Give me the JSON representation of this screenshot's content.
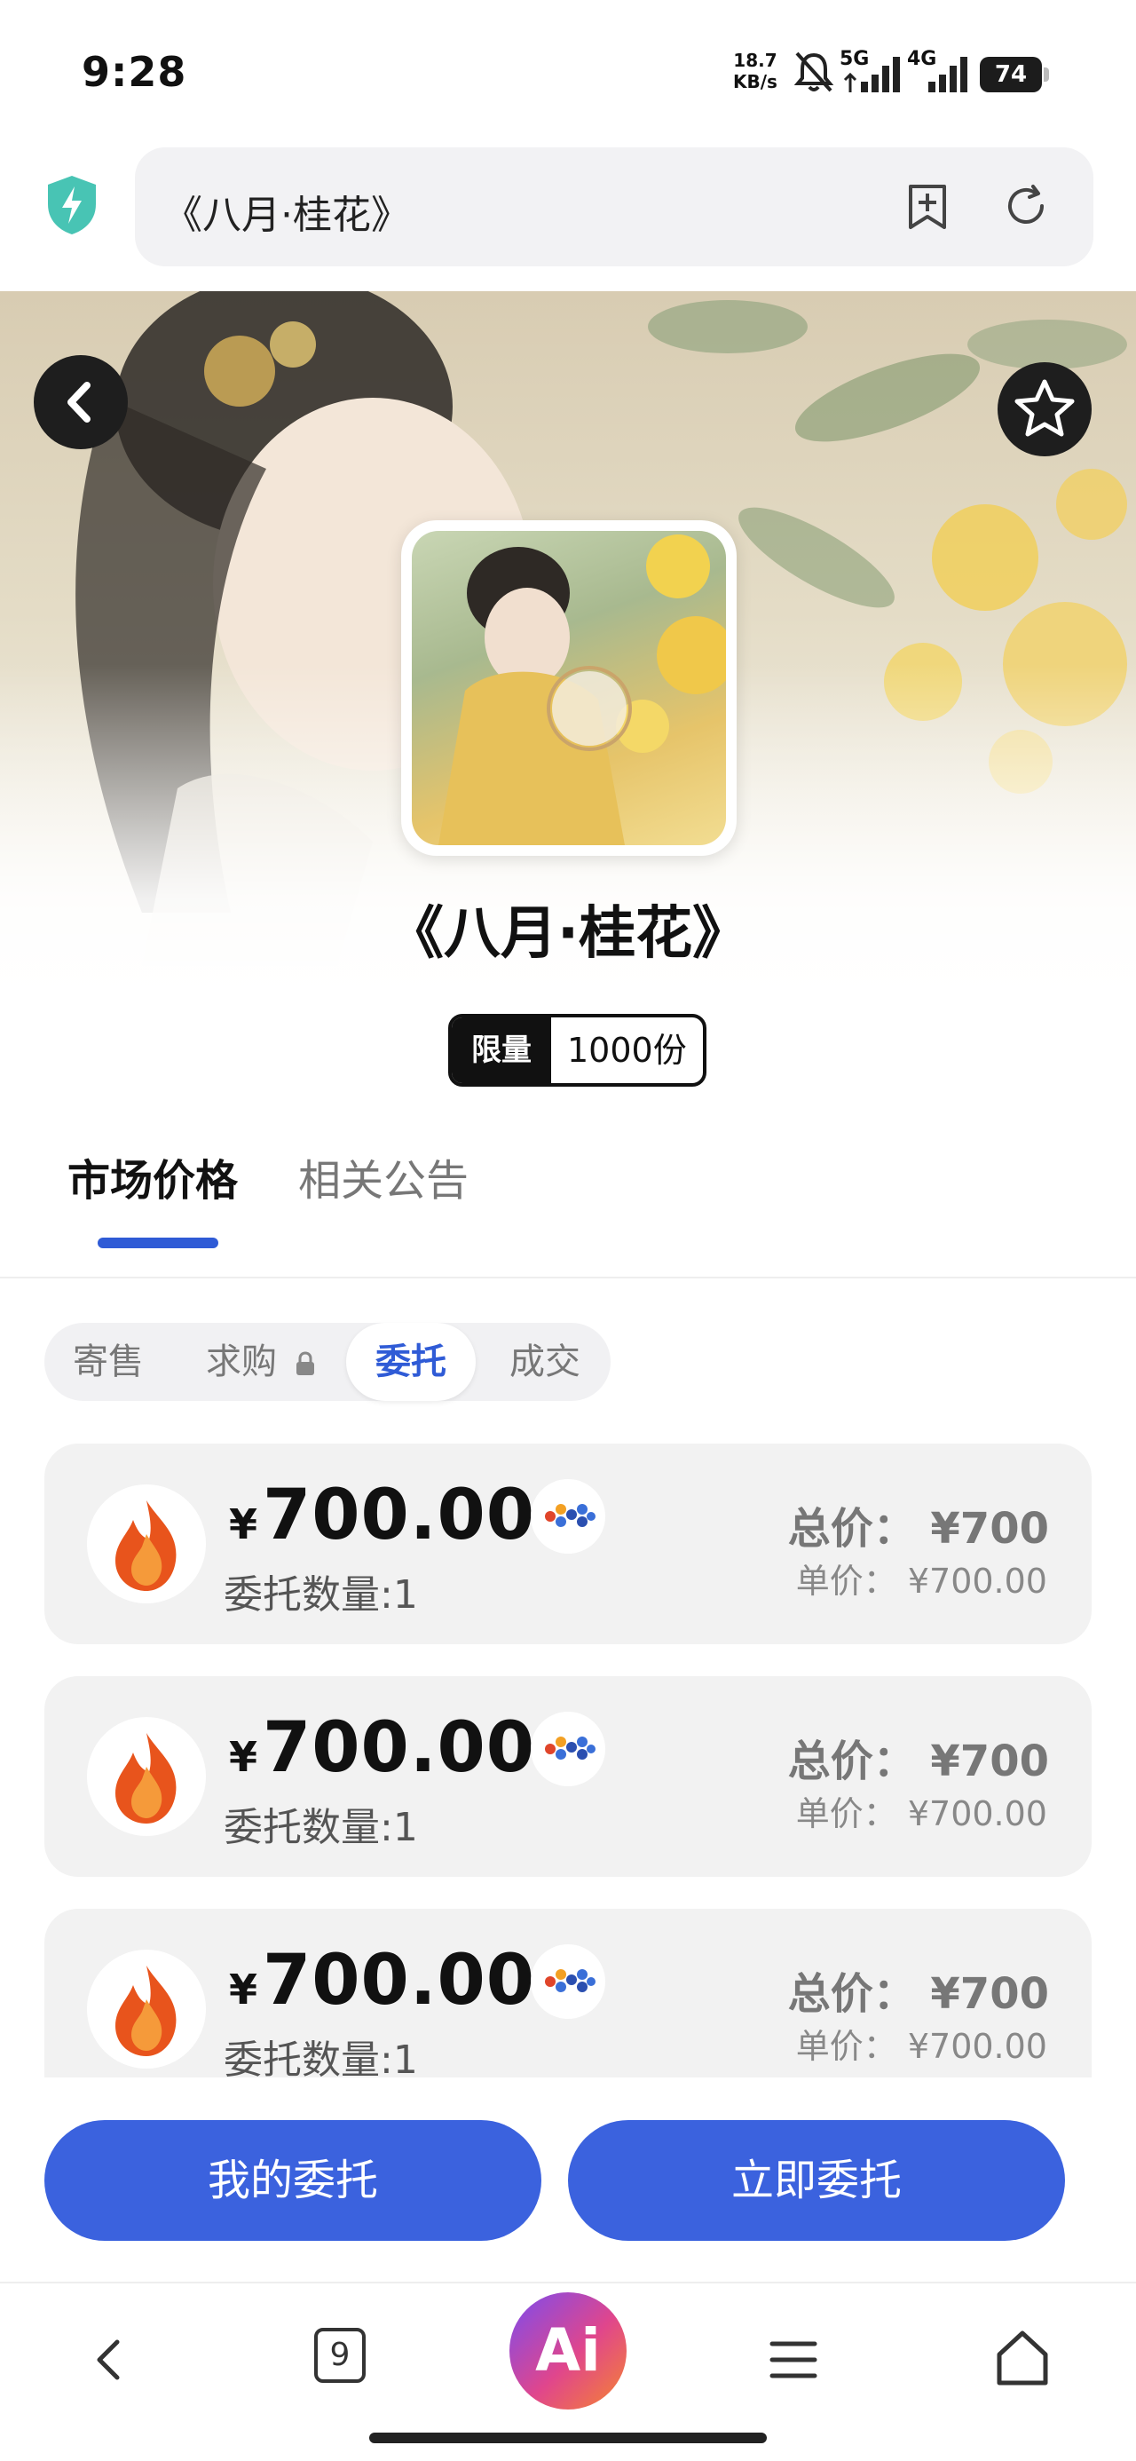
{
  "status_bar": {
    "time": "9:28",
    "net_speed_value": "18.7",
    "net_speed_unit": "KB/s",
    "sim1": "5G",
    "sim2": "4G",
    "battery": "74"
  },
  "url_bar": {
    "title": "《八月·桂花》"
  },
  "hero": {
    "title": "《八月·桂花》",
    "limit_label": "限量",
    "limit_value": "1000份"
  },
  "tabs": [
    {
      "label": "市场价格",
      "active": true
    },
    {
      "label": "相关公告",
      "active": false
    }
  ],
  "segments": [
    {
      "label": "寄售",
      "active": false
    },
    {
      "label": "求购",
      "active": false,
      "locked": true
    },
    {
      "label": "委托",
      "active": true
    },
    {
      "label": "成交",
      "active": false
    }
  ],
  "orders": [
    {
      "yen": "¥",
      "price": "700.00",
      "qty": "委托数量:1",
      "total": "总价： ¥700",
      "unit": "单价： ¥700.00"
    },
    {
      "yen": "¥",
      "price": "700.00",
      "qty": "委托数量:1",
      "total": "总价： ¥700",
      "unit": "单价： ¥700.00"
    },
    {
      "yen": "¥",
      "price": "700.00",
      "qty": "委托数量:1",
      "total": "总价： ¥700",
      "unit": "单价： ¥700.00"
    }
  ],
  "buttons": {
    "my_orders": "我的委托",
    "order_now": "立即委托"
  },
  "bottom_nav": {
    "tab_count": "9",
    "ai_label": "Ai"
  },
  "colors": {
    "accent": "#3b62de",
    "tab_indicator": "#2f5bd6"
  }
}
